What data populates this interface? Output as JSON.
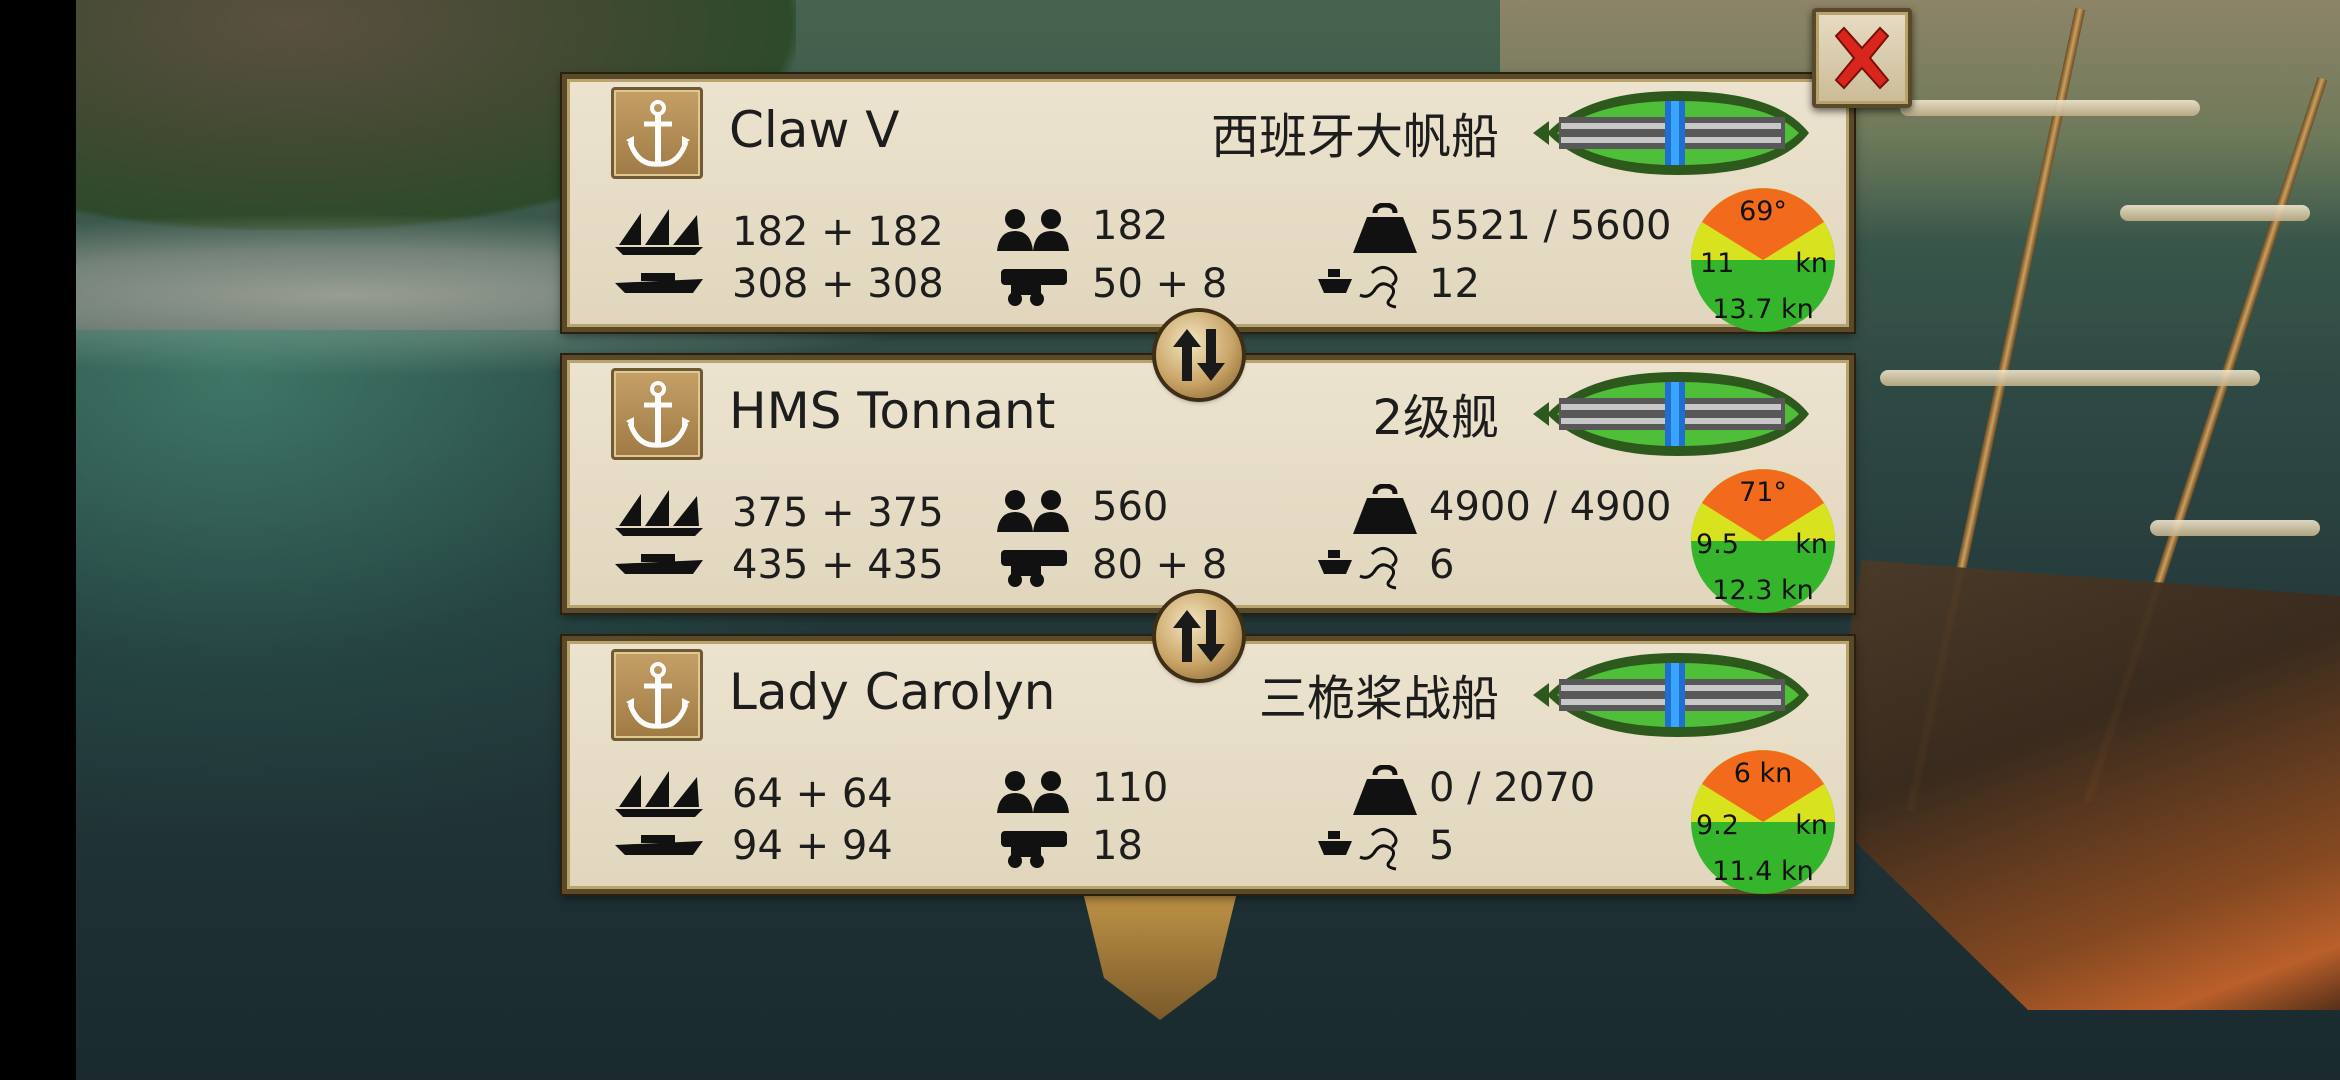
{
  "colors": {
    "panel_bg": "#e6dcc5",
    "panel_border": "#5b4a2a",
    "gauge_red": "#f26a1b",
    "gauge_yellow": "#d9e21e",
    "gauge_green": "#35b52c",
    "close_red": "#d8261c"
  },
  "icons": {
    "anchor": "anchor-icon",
    "sails": "sails-icon",
    "hull": "hull-icon",
    "crew": "crew-icon",
    "cannon": "cannon-icon",
    "cargo": "weight-icon",
    "boarding": "grappling-hook-icon",
    "swap": "swap-arrows-icon",
    "close": "close-icon"
  },
  "ships": [
    {
      "name": "Claw V",
      "class": "西班牙大帆船",
      "sails": "182 + 182",
      "hull": "308 + 308",
      "crew": "182",
      "cannons": "50 + 8",
      "cargo": "5521 / 5600",
      "boarding": "12",
      "gauge": {
        "top": "69°",
        "left": "11",
        "right": "kn",
        "bottom": "13.7 kn"
      }
    },
    {
      "name": "HMS Tonnant",
      "class": "2级舰",
      "sails": "375 + 375",
      "hull": "435 + 435",
      "crew": "560",
      "cannons": "80 + 8",
      "cargo": "4900 / 4900",
      "boarding": "6",
      "gauge": {
        "top": "71°",
        "left": "9.5",
        "right": "kn",
        "bottom": "12.3 kn"
      }
    },
    {
      "name": "Lady Carolyn",
      "class": "三桅桨战船",
      "sails": "64 + 64",
      "hull": "94 + 94",
      "crew": "110",
      "cannons": "18",
      "cargo": "0 / 2070",
      "boarding": "5",
      "gauge": {
        "top": "6 kn",
        "left": "9.2",
        "right": "kn",
        "bottom": "11.4 kn"
      }
    }
  ]
}
